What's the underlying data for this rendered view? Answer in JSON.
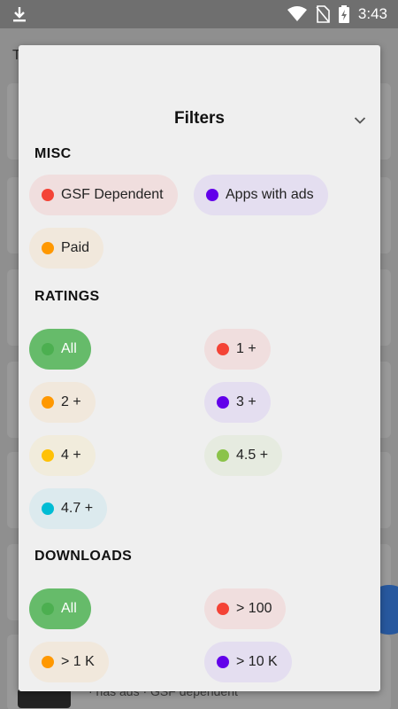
{
  "statusbar": {
    "time": "3:43",
    "icons": [
      "download-icon",
      "wifi-icon",
      "no-sim-icon",
      "battery-charging-icon"
    ]
  },
  "background": {
    "title": "T",
    "footer_text": "· has ads · GSF dependent"
  },
  "sheet": {
    "title": "Filters",
    "collapse_icon": "chevron-down-icon",
    "sections": {
      "misc": {
        "heading": "MISC",
        "chips": [
          {
            "label": "GSF Dependent",
            "dot": "#f44336",
            "bg": "#f0dede"
          },
          {
            "label": "Apps with ads",
            "dot": "#6200ea",
            "bg": "#e4def0"
          },
          {
            "label": "Paid",
            "dot": "#ff9800",
            "bg": "#f1e8dc"
          }
        ]
      },
      "ratings": {
        "heading": "RATINGS",
        "chips": [
          {
            "label": "All",
            "dot": "#4caf50",
            "selected": true
          },
          {
            "label": "1 +",
            "dot": "#f44336",
            "bg": "#f0dede"
          },
          {
            "label": "2 +",
            "dot": "#ff9800",
            "bg": "#f1e8dc"
          },
          {
            "label": "3 +",
            "dot": "#6200ea",
            "bg": "#e4def0"
          },
          {
            "label": "4 +",
            "dot": "#ffc107",
            "bg": "#f1ecdc"
          },
          {
            "label": "4.5 +",
            "dot": "#8bc34a",
            "bg": "#e6ebe0"
          },
          {
            "label": "4.7 +",
            "dot": "#00bcd4",
            "bg": "#dceaee"
          }
        ]
      },
      "downloads": {
        "heading": "DOWNLOADS",
        "chips": [
          {
            "label": "All",
            "dot": "#4caf50",
            "selected": true
          },
          {
            "label": "> 100",
            "dot": "#f44336",
            "bg": "#f0dede"
          },
          {
            "label": "> 1 K",
            "dot": "#ff9800",
            "bg": "#f1e8dc"
          },
          {
            "label": "> 10 K",
            "dot": "#6200ea",
            "bg": "#e4def0"
          }
        ]
      }
    }
  }
}
